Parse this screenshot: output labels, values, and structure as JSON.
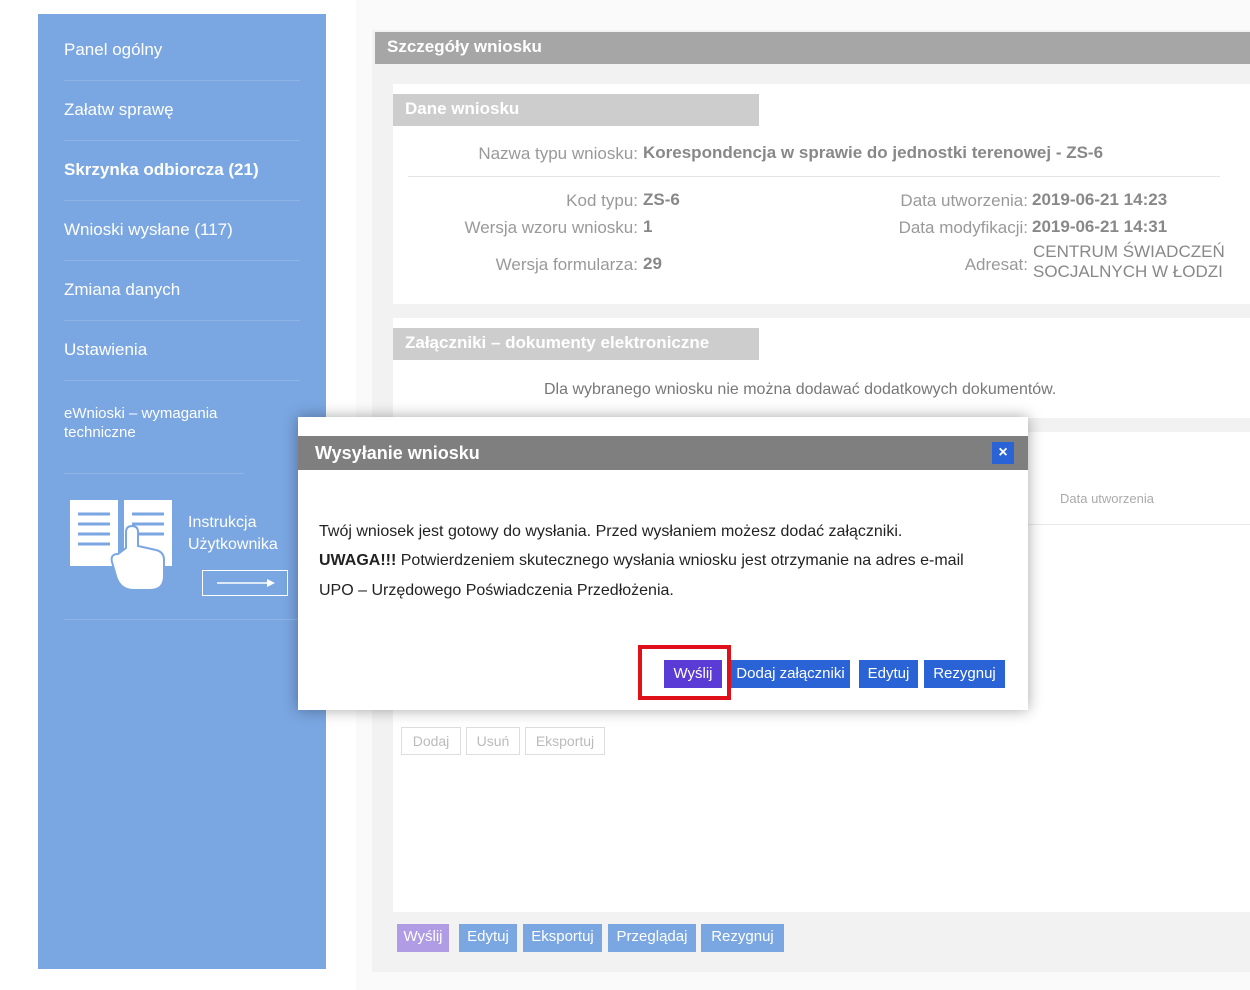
{
  "sidebar": {
    "items": [
      {
        "label": "Panel ogólny"
      },
      {
        "label": "Załatw sprawę"
      },
      {
        "label": "Skrzynka odbiorcza (21)"
      },
      {
        "label": "Wnioski wysłane (117)"
      },
      {
        "label": "Zmiana danych"
      },
      {
        "label": "Ustawienia"
      },
      {
        "label": "eWnioski – wymagania techniczne"
      }
    ],
    "manual": {
      "line1": "Instrukcja",
      "line2": "Użytkownika",
      "icon": "book-hand-icon",
      "arrow_icon": "arrow-right-icon"
    }
  },
  "main": {
    "header": "Szczegóły wniosku",
    "data_section": {
      "title": "Dane wniosku",
      "type_name_label": "Nazwa typu wniosku:",
      "type_name_value": "Korespondencja w sprawie do jednostki terenowej - ZS-6",
      "type_code_label": "Kod typu:",
      "type_code_value": "ZS-6",
      "template_version_label": "Wersja wzoru wniosku:",
      "template_version_value": "1",
      "form_version_label": "Wersja formularza:",
      "form_version_value": "29",
      "created_label": "Data utworzenia:",
      "created_value": "2019-06-21 14:23",
      "modified_label": "Data modyfikacji:",
      "modified_value": "2019-06-21 14:31",
      "addressee_label": "Adresat:",
      "addressee_line1": "CENTRUM ŚWIADCZEŃ",
      "addressee_line2": "SOCJALNYCH W ŁODZI"
    },
    "attachments_section": {
      "title": "Załączniki – dokumenty elektroniczne",
      "message": "Dla wybranego wniosku nie można dodawać dodatkowych dokumentów."
    },
    "list_section": {
      "column_created": "Data utworzenia",
      "buttons": {
        "add": "Dodaj",
        "remove": "Usuń",
        "export": "Eksportuj"
      }
    },
    "bottom_buttons": {
      "send": "Wyślij",
      "edit": "Edytuj",
      "export": "Eksportuj",
      "browse": "Przeglądaj",
      "cancel": "Rezygnuj"
    }
  },
  "dialog": {
    "title": "Wysyłanie wniosku",
    "close": "×",
    "line1": "Twój wniosek jest gotowy do wysłania. Przed wysłaniem możesz dodać załączniki.",
    "line2_bold": "UWAGA!!!",
    "line2_rest": " Potwierdzeniem skutecznego wysłania wniosku jest otrzymanie na adres e-mail",
    "line3": "UPO – Urzędowego Poświadczenia Przedłożenia.",
    "buttons": {
      "send": "Wyślij",
      "add_attachments": "Dodaj załączniki",
      "edit": "Edytuj",
      "cancel": "Rezygnuj"
    },
    "highlight_color": "#e0101b"
  }
}
